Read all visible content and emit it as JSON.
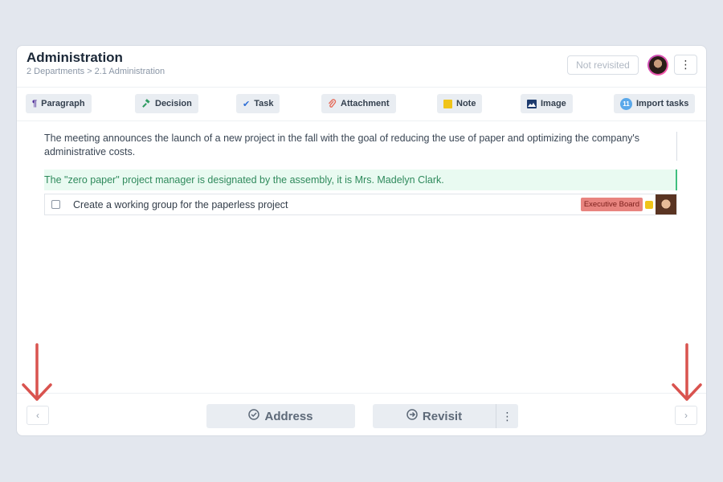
{
  "header": {
    "title": "Administration",
    "breadcrumb": "2 Departments > 2.1 Administration",
    "status_label": "Not revisited",
    "more_icon": "vertical-ellipsis-icon"
  },
  "toolbar": {
    "items": [
      {
        "label": "Paragraph",
        "icon": "paragraph-icon",
        "color": "#5a3b9f"
      },
      {
        "label": "Decision",
        "icon": "gavel-icon",
        "color": "#2f9b62"
      },
      {
        "label": "Task",
        "icon": "check-icon",
        "color": "#2f6fd6"
      },
      {
        "label": "Attachment",
        "icon": "paperclip-icon",
        "color": "#e56b5a"
      },
      {
        "label": "Note",
        "icon": "sticky-note-icon",
        "color": "#f0c419"
      },
      {
        "label": "Image",
        "icon": "image-icon",
        "color": "#1d3b6e"
      },
      {
        "label": "Import tasks",
        "icon": "badge-11-icon",
        "color": "#5aa8ea",
        "badge": "11"
      }
    ]
  },
  "content": {
    "paragraph": "The meeting announces the launch of a new project in the fall with the goal of reducing the use of paper and optimizing the company's administrative costs.",
    "decision": "The \"zero paper\" project manager is designated by the assembly, it is Mrs. Madelyn Clark.",
    "task": {
      "text": "Create a working group for the paperless project",
      "tag": "Executive Board",
      "tag_color": "#e8847f",
      "priority_color": "#f0c419"
    }
  },
  "footer": {
    "prev_icon": "chevron-left-icon",
    "next_icon": "chevron-right-icon",
    "address_label": "Address",
    "revisit_label": "Revisit"
  },
  "annotations": {
    "arrow_color": "#d9534f"
  }
}
